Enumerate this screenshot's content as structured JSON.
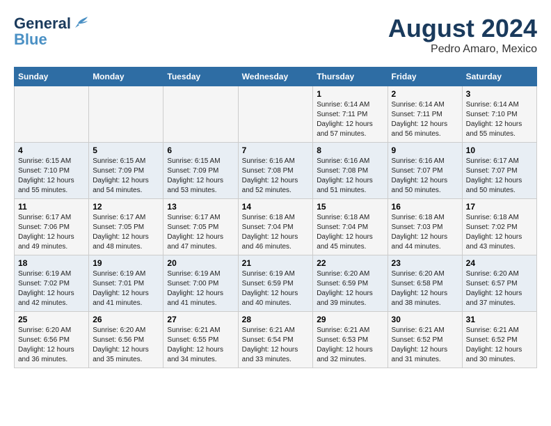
{
  "header": {
    "logo_general": "General",
    "logo_blue": "Blue",
    "main_title": "August 2024",
    "subtitle": "Pedro Amaro, Mexico"
  },
  "columns": [
    "Sunday",
    "Monday",
    "Tuesday",
    "Wednesday",
    "Thursday",
    "Friday",
    "Saturday"
  ],
  "weeks": [
    {
      "days": [
        {
          "num": "",
          "info": ""
        },
        {
          "num": "",
          "info": ""
        },
        {
          "num": "",
          "info": ""
        },
        {
          "num": "",
          "info": ""
        },
        {
          "num": "1",
          "info": "Sunrise: 6:14 AM\nSunset: 7:11 PM\nDaylight: 12 hours\nand 57 minutes."
        },
        {
          "num": "2",
          "info": "Sunrise: 6:14 AM\nSunset: 7:11 PM\nDaylight: 12 hours\nand 56 minutes."
        },
        {
          "num": "3",
          "info": "Sunrise: 6:14 AM\nSunset: 7:10 PM\nDaylight: 12 hours\nand 55 minutes."
        }
      ]
    },
    {
      "days": [
        {
          "num": "4",
          "info": "Sunrise: 6:15 AM\nSunset: 7:10 PM\nDaylight: 12 hours\nand 55 minutes."
        },
        {
          "num": "5",
          "info": "Sunrise: 6:15 AM\nSunset: 7:09 PM\nDaylight: 12 hours\nand 54 minutes."
        },
        {
          "num": "6",
          "info": "Sunrise: 6:15 AM\nSunset: 7:09 PM\nDaylight: 12 hours\nand 53 minutes."
        },
        {
          "num": "7",
          "info": "Sunrise: 6:16 AM\nSunset: 7:08 PM\nDaylight: 12 hours\nand 52 minutes."
        },
        {
          "num": "8",
          "info": "Sunrise: 6:16 AM\nSunset: 7:08 PM\nDaylight: 12 hours\nand 51 minutes."
        },
        {
          "num": "9",
          "info": "Sunrise: 6:16 AM\nSunset: 7:07 PM\nDaylight: 12 hours\nand 50 minutes."
        },
        {
          "num": "10",
          "info": "Sunrise: 6:17 AM\nSunset: 7:07 PM\nDaylight: 12 hours\nand 50 minutes."
        }
      ]
    },
    {
      "days": [
        {
          "num": "11",
          "info": "Sunrise: 6:17 AM\nSunset: 7:06 PM\nDaylight: 12 hours\nand 49 minutes."
        },
        {
          "num": "12",
          "info": "Sunrise: 6:17 AM\nSunset: 7:05 PM\nDaylight: 12 hours\nand 48 minutes."
        },
        {
          "num": "13",
          "info": "Sunrise: 6:17 AM\nSunset: 7:05 PM\nDaylight: 12 hours\nand 47 minutes."
        },
        {
          "num": "14",
          "info": "Sunrise: 6:18 AM\nSunset: 7:04 PM\nDaylight: 12 hours\nand 46 minutes."
        },
        {
          "num": "15",
          "info": "Sunrise: 6:18 AM\nSunset: 7:04 PM\nDaylight: 12 hours\nand 45 minutes."
        },
        {
          "num": "16",
          "info": "Sunrise: 6:18 AM\nSunset: 7:03 PM\nDaylight: 12 hours\nand 44 minutes."
        },
        {
          "num": "17",
          "info": "Sunrise: 6:18 AM\nSunset: 7:02 PM\nDaylight: 12 hours\nand 43 minutes."
        }
      ]
    },
    {
      "days": [
        {
          "num": "18",
          "info": "Sunrise: 6:19 AM\nSunset: 7:02 PM\nDaylight: 12 hours\nand 42 minutes."
        },
        {
          "num": "19",
          "info": "Sunrise: 6:19 AM\nSunset: 7:01 PM\nDaylight: 12 hours\nand 41 minutes."
        },
        {
          "num": "20",
          "info": "Sunrise: 6:19 AM\nSunset: 7:00 PM\nDaylight: 12 hours\nand 41 minutes."
        },
        {
          "num": "21",
          "info": "Sunrise: 6:19 AM\nSunset: 6:59 PM\nDaylight: 12 hours\nand 40 minutes."
        },
        {
          "num": "22",
          "info": "Sunrise: 6:20 AM\nSunset: 6:59 PM\nDaylight: 12 hours\nand 39 minutes."
        },
        {
          "num": "23",
          "info": "Sunrise: 6:20 AM\nSunset: 6:58 PM\nDaylight: 12 hours\nand 38 minutes."
        },
        {
          "num": "24",
          "info": "Sunrise: 6:20 AM\nSunset: 6:57 PM\nDaylight: 12 hours\nand 37 minutes."
        }
      ]
    },
    {
      "days": [
        {
          "num": "25",
          "info": "Sunrise: 6:20 AM\nSunset: 6:56 PM\nDaylight: 12 hours\nand 36 minutes."
        },
        {
          "num": "26",
          "info": "Sunrise: 6:20 AM\nSunset: 6:56 PM\nDaylight: 12 hours\nand 35 minutes."
        },
        {
          "num": "27",
          "info": "Sunrise: 6:21 AM\nSunset: 6:55 PM\nDaylight: 12 hours\nand 34 minutes."
        },
        {
          "num": "28",
          "info": "Sunrise: 6:21 AM\nSunset: 6:54 PM\nDaylight: 12 hours\nand 33 minutes."
        },
        {
          "num": "29",
          "info": "Sunrise: 6:21 AM\nSunset: 6:53 PM\nDaylight: 12 hours\nand 32 minutes."
        },
        {
          "num": "30",
          "info": "Sunrise: 6:21 AM\nSunset: 6:52 PM\nDaylight: 12 hours\nand 31 minutes."
        },
        {
          "num": "31",
          "info": "Sunrise: 6:21 AM\nSunset: 6:52 PM\nDaylight: 12 hours\nand 30 minutes."
        }
      ]
    }
  ]
}
